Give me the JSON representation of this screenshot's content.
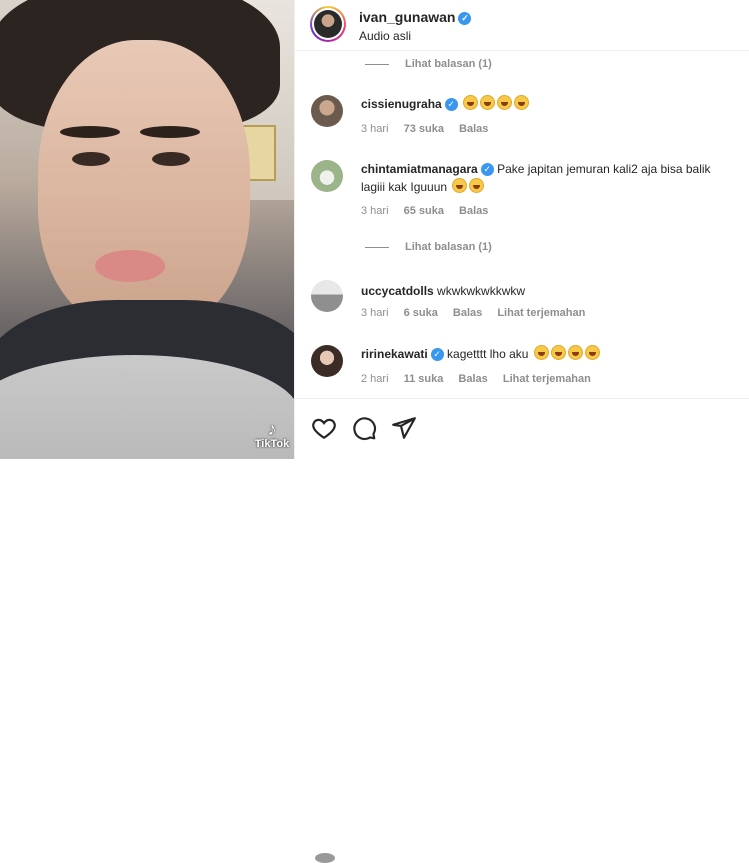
{
  "media": {
    "watermark": "TikTok"
  },
  "post": {
    "username": "ivan_gunawan",
    "subtitle": "Audio asli"
  },
  "view_replies_1": "Lihat balasan (1)",
  "view_replies_2": "Lihat balasan (1)",
  "comments": [
    {
      "username": "cissienugraha",
      "text": "",
      "emojis": 4,
      "time": "3 hari",
      "likes": "73 suka",
      "reply": "Balas",
      "translate": ""
    },
    {
      "username": "chintamiatmanagara",
      "text": "Pake japitan jemuran kali2 aja bisa balik lagiii kak Iguuun",
      "emojis": 2,
      "time": "3 hari",
      "likes": "65 suka",
      "reply": "Balas",
      "translate": ""
    },
    {
      "username": "uccycatdolls",
      "text": "wkwkwkwkkwkw",
      "emojis": 0,
      "time": "3 hari",
      "likes": "6 suka",
      "reply": "Balas",
      "translate": "Lihat terjemahan"
    },
    {
      "username": "ririnekawati",
      "text": "kagetttt lho aku",
      "emojis": 4,
      "time": "2 hari",
      "likes": "11 suka",
      "reply": "Balas",
      "translate": "Lihat terjemahan"
    }
  ],
  "icons": [
    "heart-icon",
    "comment-icon",
    "share-icon"
  ]
}
